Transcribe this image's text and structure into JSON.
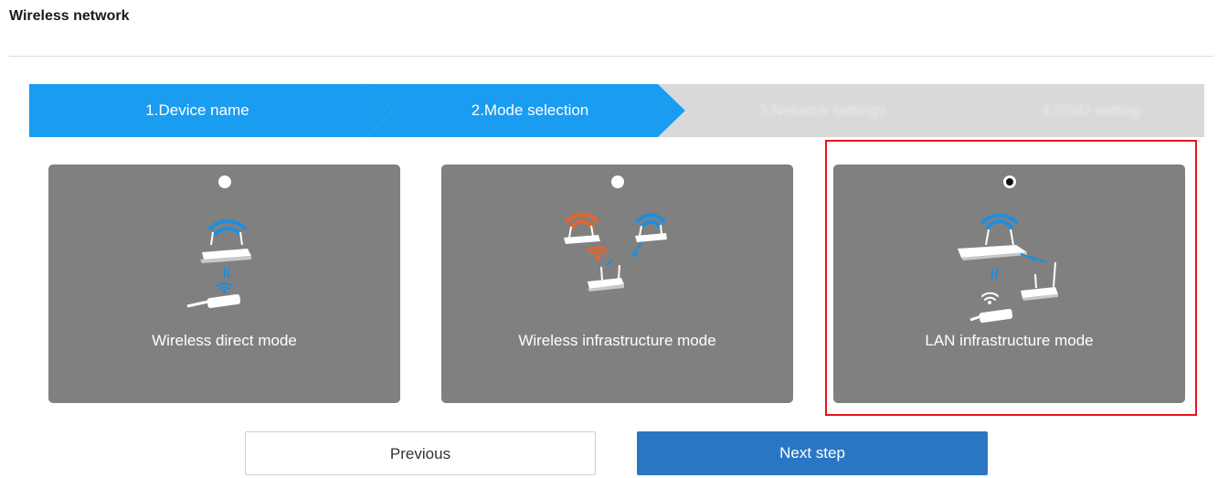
{
  "page": {
    "title": "Wireless network"
  },
  "stepper": {
    "steps": [
      {
        "label": "1.Device name",
        "state": "active"
      },
      {
        "label": "2.Mode selection",
        "state": "active"
      },
      {
        "label": "3.Network settings",
        "state": "inactive"
      },
      {
        "label": "4.SSID setting",
        "state": "inactive"
      }
    ],
    "active_color": "#1a9cf0",
    "inactive_color": "#d9d9d9"
  },
  "modes": [
    {
      "label": "Wireless direct mode",
      "selected": false,
      "icon": "router-to-dongle-icon"
    },
    {
      "label": "Wireless infrastructure mode",
      "selected": false,
      "icon": "router-to-router-dongle-icon"
    },
    {
      "label": "LAN infrastructure mode",
      "selected": true,
      "icon": "router-lan-dongle-icon"
    }
  ],
  "buttons": {
    "previous": "Previous",
    "next": "Next step"
  },
  "colors": {
    "card_bg": "#808080",
    "highlight": "#e8141f",
    "wifi_blue": "#1a8fe0",
    "wifi_orange": "#e8642a",
    "next_button": "#2b76c4"
  }
}
